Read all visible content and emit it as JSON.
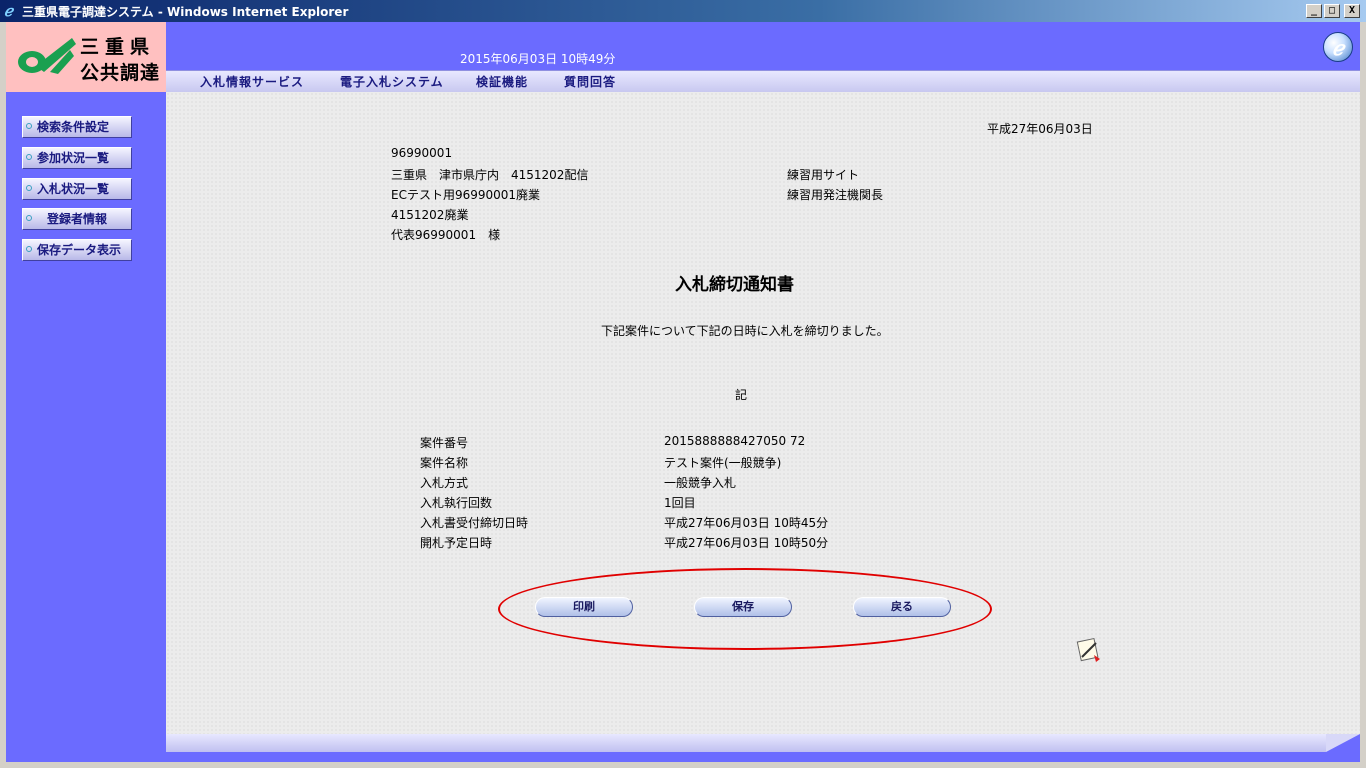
{
  "window": {
    "title": "三重県電子調達システム - Windows Internet Explorer",
    "icon": "ie-icon",
    "controls": [
      "_",
      "□",
      "X"
    ]
  },
  "logo": {
    "line1": "三重県",
    "line2": "公共調達"
  },
  "header": {
    "datetime": "2015年06月03日 10時49分"
  },
  "menu": {
    "items": [
      {
        "label": "入札情報サービス"
      },
      {
        "label": "電子入札システム"
      },
      {
        "label": "検証機能"
      },
      {
        "label": "質問回答"
      }
    ]
  },
  "sidebar": {
    "items": [
      {
        "label": "検索条件設定"
      },
      {
        "label": "参加状況一覧"
      },
      {
        "label": "入札状況一覧"
      },
      {
        "label": "登録者情報"
      },
      {
        "label": "保存データ表示"
      }
    ]
  },
  "document": {
    "date": "平成27年06月03日",
    "recipient": {
      "id": "96990001",
      "address": "三重県　津市県庁内　4151202配信",
      "company": "ECテスト用96990001廃業",
      "branch": "4151202廃業",
      "representative": "代表96990001　様"
    },
    "sender": {
      "site": "練習用サイト",
      "office": "練習用発注機関長"
    },
    "title": "入札締切通知書",
    "message": "下記案件について下記の日時に入札を締切りました。",
    "ki": "記",
    "fields": [
      {
        "label": "案件番号",
        "value": "2015888888427050 72"
      },
      {
        "label": "案件名称",
        "value": "テスト案件(一般競争)"
      },
      {
        "label": "入札方式",
        "value": "一般競争入札"
      },
      {
        "label": "入札執行回数",
        "value": "1回目"
      },
      {
        "label": "入札書受付締切日時",
        "value": "平成27年06月03日 10時45分"
      },
      {
        "label": "開札予定日時",
        "value": "平成27年06月03日 10時50分"
      }
    ]
  },
  "actions": {
    "print": "印刷",
    "save": "保存",
    "back": "戻る"
  },
  "colors": {
    "frame": "#6b6bff",
    "logo_bg": "#ffc0c0",
    "annotation": "#e00000"
  }
}
